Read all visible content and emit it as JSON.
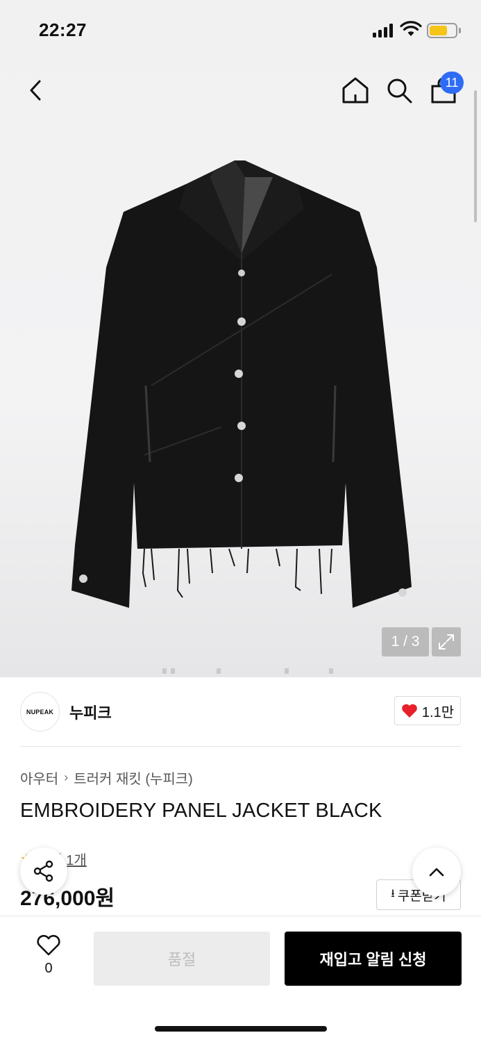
{
  "status": {
    "time": "22:27",
    "battery_color": "#f5c518"
  },
  "nav": {
    "back_icon": "chevron-left-icon",
    "home_icon": "home-icon",
    "search_icon": "search-icon",
    "cart_icon": "shopping-bag-icon",
    "cart_badge": "11",
    "badge_color": "#2e6cf6"
  },
  "gallery": {
    "pager": "1 / 3",
    "expand_icon": "expand-icon"
  },
  "brand": {
    "logo_text": "NUPEAK",
    "name": "누피크",
    "likes": "1.1만",
    "like_color": "#e8202a"
  },
  "product": {
    "breadcrumb": [
      "아우터",
      "트러커 재킷 (누피크)"
    ],
    "title": "EMBROIDERY PANEL JACKET BLACK",
    "review_label": "후기 1개",
    "price": "276,000원",
    "coupon_label": "쿠폰받기"
  },
  "bottom": {
    "wish_count": "0",
    "soldout_label": "품절",
    "restock_label": "재입고 알림 신청"
  }
}
